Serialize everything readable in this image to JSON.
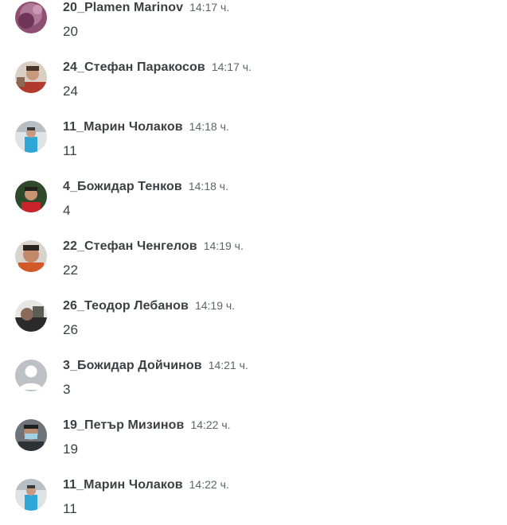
{
  "messages": [
    {
      "author": "20_Plamen Marinov",
      "time": "14:17 ч.",
      "text": "20",
      "avatar": "photo-purple"
    },
    {
      "author": "24_Стефан Паракосов",
      "time": "14:17 ч.",
      "text": "24",
      "avatar": "photo-red-shirt"
    },
    {
      "author": "11_Марин Чолаков",
      "time": "14:18 ч.",
      "text": "11",
      "avatar": "photo-snow-blue"
    },
    {
      "author": "4_Божидар Тенков",
      "time": "14:18 ч.",
      "text": "4",
      "avatar": "photo-green-red"
    },
    {
      "author": "22_Стефан Ченгелов",
      "time": "14:19 ч.",
      "text": "22",
      "avatar": "photo-face-orange"
    },
    {
      "author": "26_Теодор Лебанов",
      "time": "14:19 ч.",
      "text": "26",
      "avatar": "photo-dark"
    },
    {
      "author": "3_Божидар Дойчинов",
      "time": "14:21 ч.",
      "text": "3",
      "avatar": "default-person"
    },
    {
      "author": "19_Петър Мизинов",
      "time": "14:22 ч.",
      "text": "19",
      "avatar": "photo-mask"
    },
    {
      "author": "11_Марин Чолаков",
      "time": "14:22 ч.",
      "text": "11",
      "avatar": "photo-snow-blue"
    }
  ],
  "colors": {
    "name": "#3c4043",
    "time": "#5f6368",
    "text": "#3c4043",
    "default_avatar_bg": "#bdc1c6"
  }
}
